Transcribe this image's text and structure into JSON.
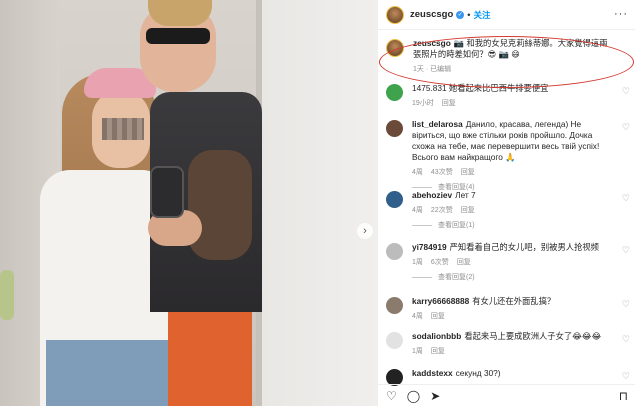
{
  "header": {
    "username": "zeuscsgo",
    "verified_mark": "✓",
    "separator": "•",
    "follow_label": "关注",
    "more_label": "···"
  },
  "photo": {
    "next_arrow": "›"
  },
  "caption": {
    "username": "zeuscsgo",
    "text": "📷 和我的女兒克莉絲蒂娜。大家覺得這兩張照片的時差如何？😎 📷 😄",
    "meta": "1天 · 已编辑"
  },
  "comments": [
    {
      "username": "",
      "text": "1475.831 她看起來比巴西牛排要便宜",
      "time": "19小时",
      "likes": "",
      "reply_label": "回复",
      "replies_label": "",
      "avatar_color": "#3fa34d"
    },
    {
      "username": "list_delarosa",
      "text": "Данило, красава, легенда) Не віриться, що вже стільки років пройшло. Дочка схожа на тебе, має перевершити весь твій успіх! Всього вам найкращого 🙏",
      "time": "4周",
      "likes": "43次赞",
      "reply_label": "回复",
      "replies_label": "查看回复(4)",
      "avatar_color": "#6b4a3a"
    },
    {
      "username": "abehoziev",
      "text": "Лет 7",
      "time": "4周",
      "likes": "22次赞",
      "reply_label": "回复",
      "replies_label": "查看回复(1)",
      "avatar_color": "#2f5f8a"
    },
    {
      "username": "yi784919",
      "text": "严知看着自己的女儿吧，别被男人抢视频",
      "time": "1周",
      "likes": "6次赞",
      "reply_label": "回复",
      "replies_label": "查看回复(2)",
      "avatar_color": "#bcbcbc"
    },
    {
      "username": "karry66668888",
      "text": "有女儿还在外面乱搞？",
      "time": "4周",
      "likes": "",
      "reply_label": "回复",
      "replies_label": "",
      "avatar_color": "#8a7b6c"
    },
    {
      "username": "sodalionbbb",
      "text": "看起来马上要成欧洲人子女了😂😂😂",
      "time": "1周",
      "likes": "",
      "reply_label": "回复",
      "replies_label": "",
      "avatar_color": "#e2e2e2"
    },
    {
      "username": "kaddstexx",
      "text": "секунд 30?)",
      "time": "",
      "likes": "",
      "reply_label": "",
      "replies_label": "",
      "avatar_color": "#222222"
    }
  ],
  "icons": {
    "heart": "♡",
    "like_action": "♡",
    "comment_action": "◯",
    "share_action": "➤",
    "bookmark_action": "⊓"
  },
  "colors": {
    "accent": "#0095f6",
    "highlight_oval": "#d23a30"
  }
}
